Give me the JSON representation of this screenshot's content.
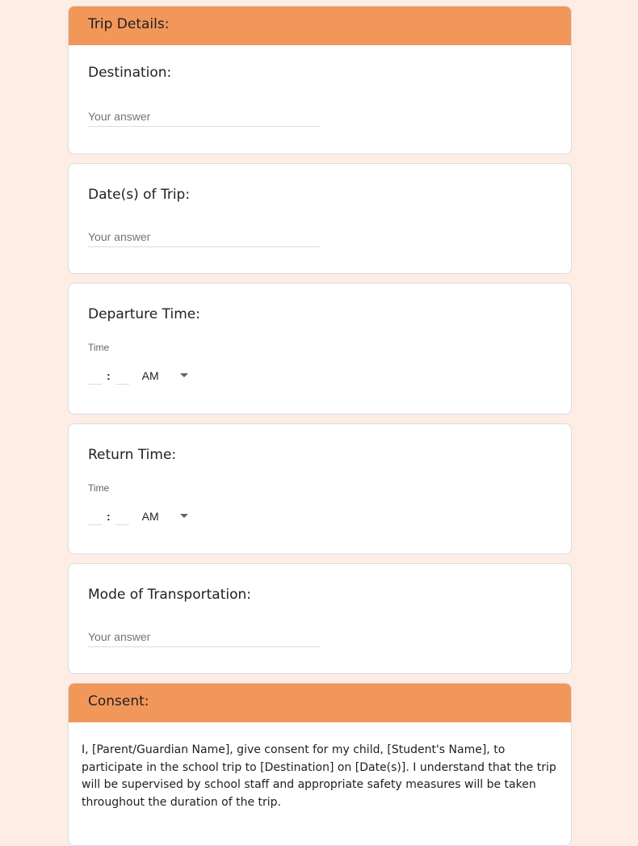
{
  "sections": {
    "trip_details": "Trip Details:",
    "consent": "Consent:"
  },
  "questions": {
    "destination": {
      "label": "Destination:",
      "placeholder": "Your answer"
    },
    "dates": {
      "label": "Date(s) of Trip:",
      "placeholder": "Your answer"
    },
    "departure": {
      "label": "Departure Time:",
      "time_label": "Time",
      "colon": ":",
      "ampm": "AM"
    },
    "return": {
      "label": "Return Time:",
      "time_label": "Time",
      "colon": ":",
      "ampm": "AM"
    },
    "transport": {
      "label": "Mode of Transportation:",
      "placeholder": "Your answer"
    }
  },
  "consent_text": "I, [Parent/Guardian Name], give consent for my child, [Student's Name], to participate in the school trip to [Destination] on [Date(s)]. I understand that the trip will be supervised by school staff and appropriate safety measures will be taken throughout the duration of the trip.",
  "colors": {
    "header": "#f2975a",
    "background": "#fdede4"
  }
}
